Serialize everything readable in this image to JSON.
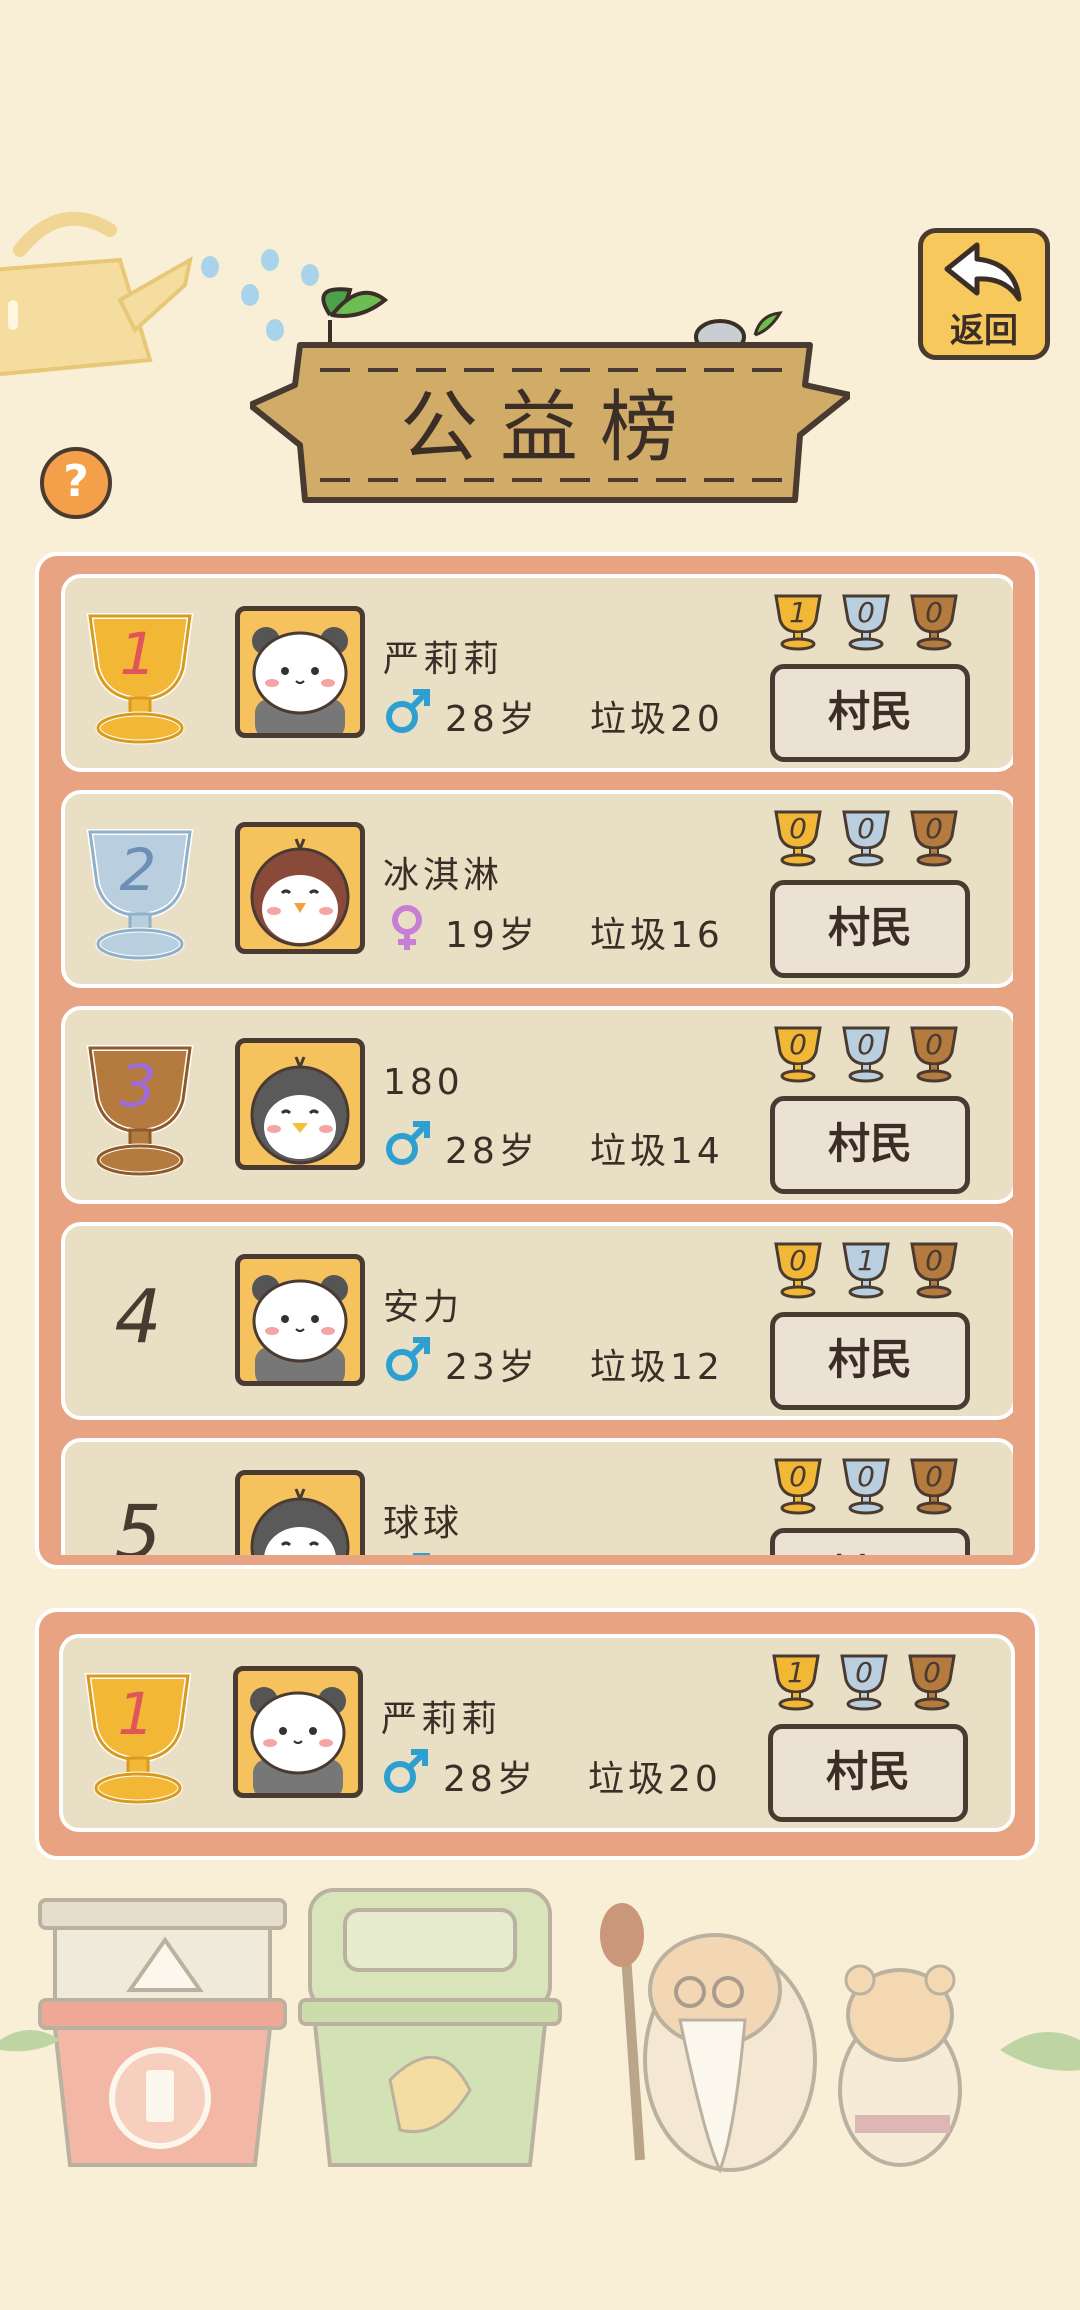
{
  "title": "公益榜",
  "back_label": "返回",
  "help_label": "?",
  "colors": {
    "background": "#f8efd6",
    "panel": "#e8a382",
    "row": "#e9dfc4",
    "gold": "#f2b835",
    "silver": "#b9cfe0",
    "bronze": "#b57a3e",
    "male": "#2d9fd0",
    "female": "#c77fd6"
  },
  "ranking": [
    {
      "rank": "1",
      "cup": "gold",
      "name": "严莉莉",
      "gender": "male",
      "age": "28岁",
      "trash": "垃圾20",
      "avatar": "panda",
      "medals": [
        "1",
        "0",
        "0"
      ],
      "role": "村民"
    },
    {
      "rank": "2",
      "cup": "silver",
      "name": "冰淇淋",
      "gender": "female",
      "age": "19岁",
      "trash": "垃圾16",
      "avatar": "sparrow",
      "medals": [
        "0",
        "0",
        "0"
      ],
      "role": "村民"
    },
    {
      "rank": "3",
      "cup": "bronze",
      "name": "180",
      "gender": "male",
      "age": "28岁",
      "trash": "垃圾14",
      "avatar": "penguin",
      "medals": [
        "0",
        "0",
        "0"
      ],
      "role": "村民"
    },
    {
      "rank": "4",
      "cup": "none",
      "name": "安力",
      "gender": "male",
      "age": "23岁",
      "trash": "垃圾12",
      "avatar": "panda",
      "medals": [
        "0",
        "1",
        "0"
      ],
      "role": "村民"
    },
    {
      "rank": "5",
      "cup": "none",
      "name": "球球",
      "gender": "male",
      "age": "",
      "trash": "",
      "avatar": "penguin",
      "medals": [
        "0",
        "0",
        "0"
      ],
      "role": "村民"
    }
  ],
  "me": {
    "rank": "1",
    "cup": "gold",
    "name": "严莉莉",
    "gender": "male",
    "age": "28岁",
    "trash": "垃圾20",
    "avatar": "panda",
    "medals": [
      "1",
      "0",
      "0"
    ],
    "role": "村民"
  },
  "icons": {
    "back": "back-arrow-icon",
    "help": "question-icon",
    "male": "male-icon",
    "female": "female-icon",
    "cup": "trophy-icon"
  }
}
